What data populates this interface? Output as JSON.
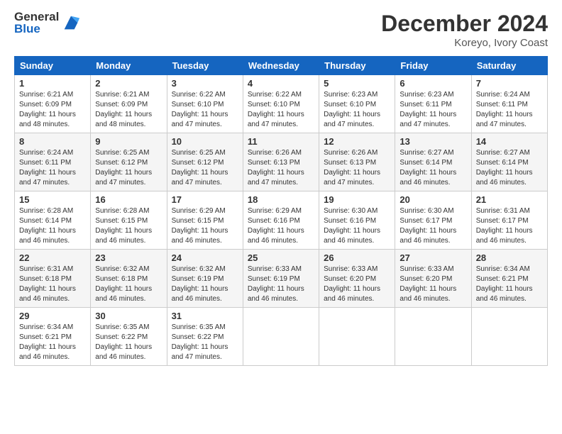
{
  "logo": {
    "general": "General",
    "blue": "Blue"
  },
  "header": {
    "title": "December 2024",
    "location": "Koreyo, Ivory Coast"
  },
  "weekdays": [
    "Sunday",
    "Monday",
    "Tuesday",
    "Wednesday",
    "Thursday",
    "Friday",
    "Saturday"
  ],
  "weeks": [
    [
      {
        "day": "1",
        "sunrise": "6:21 AM",
        "sunset": "6:09 PM",
        "daylight": "11 hours and 48 minutes."
      },
      {
        "day": "2",
        "sunrise": "6:21 AM",
        "sunset": "6:09 PM",
        "daylight": "11 hours and 48 minutes."
      },
      {
        "day": "3",
        "sunrise": "6:22 AM",
        "sunset": "6:10 PM",
        "daylight": "11 hours and 47 minutes."
      },
      {
        "day": "4",
        "sunrise": "6:22 AM",
        "sunset": "6:10 PM",
        "daylight": "11 hours and 47 minutes."
      },
      {
        "day": "5",
        "sunrise": "6:23 AM",
        "sunset": "6:10 PM",
        "daylight": "11 hours and 47 minutes."
      },
      {
        "day": "6",
        "sunrise": "6:23 AM",
        "sunset": "6:11 PM",
        "daylight": "11 hours and 47 minutes."
      },
      {
        "day": "7",
        "sunrise": "6:24 AM",
        "sunset": "6:11 PM",
        "daylight": "11 hours and 47 minutes."
      }
    ],
    [
      {
        "day": "8",
        "sunrise": "6:24 AM",
        "sunset": "6:11 PM",
        "daylight": "11 hours and 47 minutes."
      },
      {
        "day": "9",
        "sunrise": "6:25 AM",
        "sunset": "6:12 PM",
        "daylight": "11 hours and 47 minutes."
      },
      {
        "day": "10",
        "sunrise": "6:25 AM",
        "sunset": "6:12 PM",
        "daylight": "11 hours and 47 minutes."
      },
      {
        "day": "11",
        "sunrise": "6:26 AM",
        "sunset": "6:13 PM",
        "daylight": "11 hours and 47 minutes."
      },
      {
        "day": "12",
        "sunrise": "6:26 AM",
        "sunset": "6:13 PM",
        "daylight": "11 hours and 47 minutes."
      },
      {
        "day": "13",
        "sunrise": "6:27 AM",
        "sunset": "6:14 PM",
        "daylight": "11 hours and 46 minutes."
      },
      {
        "day": "14",
        "sunrise": "6:27 AM",
        "sunset": "6:14 PM",
        "daylight": "11 hours and 46 minutes."
      }
    ],
    [
      {
        "day": "15",
        "sunrise": "6:28 AM",
        "sunset": "6:14 PM",
        "daylight": "11 hours and 46 minutes."
      },
      {
        "day": "16",
        "sunrise": "6:28 AM",
        "sunset": "6:15 PM",
        "daylight": "11 hours and 46 minutes."
      },
      {
        "day": "17",
        "sunrise": "6:29 AM",
        "sunset": "6:15 PM",
        "daylight": "11 hours and 46 minutes."
      },
      {
        "day": "18",
        "sunrise": "6:29 AM",
        "sunset": "6:16 PM",
        "daylight": "11 hours and 46 minutes."
      },
      {
        "day": "19",
        "sunrise": "6:30 AM",
        "sunset": "6:16 PM",
        "daylight": "11 hours and 46 minutes."
      },
      {
        "day": "20",
        "sunrise": "6:30 AM",
        "sunset": "6:17 PM",
        "daylight": "11 hours and 46 minutes."
      },
      {
        "day": "21",
        "sunrise": "6:31 AM",
        "sunset": "6:17 PM",
        "daylight": "11 hours and 46 minutes."
      }
    ],
    [
      {
        "day": "22",
        "sunrise": "6:31 AM",
        "sunset": "6:18 PM",
        "daylight": "11 hours and 46 minutes."
      },
      {
        "day": "23",
        "sunrise": "6:32 AM",
        "sunset": "6:18 PM",
        "daylight": "11 hours and 46 minutes."
      },
      {
        "day": "24",
        "sunrise": "6:32 AM",
        "sunset": "6:19 PM",
        "daylight": "11 hours and 46 minutes."
      },
      {
        "day": "25",
        "sunrise": "6:33 AM",
        "sunset": "6:19 PM",
        "daylight": "11 hours and 46 minutes."
      },
      {
        "day": "26",
        "sunrise": "6:33 AM",
        "sunset": "6:20 PM",
        "daylight": "11 hours and 46 minutes."
      },
      {
        "day": "27",
        "sunrise": "6:33 AM",
        "sunset": "6:20 PM",
        "daylight": "11 hours and 46 minutes."
      },
      {
        "day": "28",
        "sunrise": "6:34 AM",
        "sunset": "6:21 PM",
        "daylight": "11 hours and 46 minutes."
      }
    ],
    [
      {
        "day": "29",
        "sunrise": "6:34 AM",
        "sunset": "6:21 PM",
        "daylight": "11 hours and 46 minutes."
      },
      {
        "day": "30",
        "sunrise": "6:35 AM",
        "sunset": "6:22 PM",
        "daylight": "11 hours and 46 minutes."
      },
      {
        "day": "31",
        "sunrise": "6:35 AM",
        "sunset": "6:22 PM",
        "daylight": "11 hours and 47 minutes."
      },
      null,
      null,
      null,
      null
    ]
  ]
}
